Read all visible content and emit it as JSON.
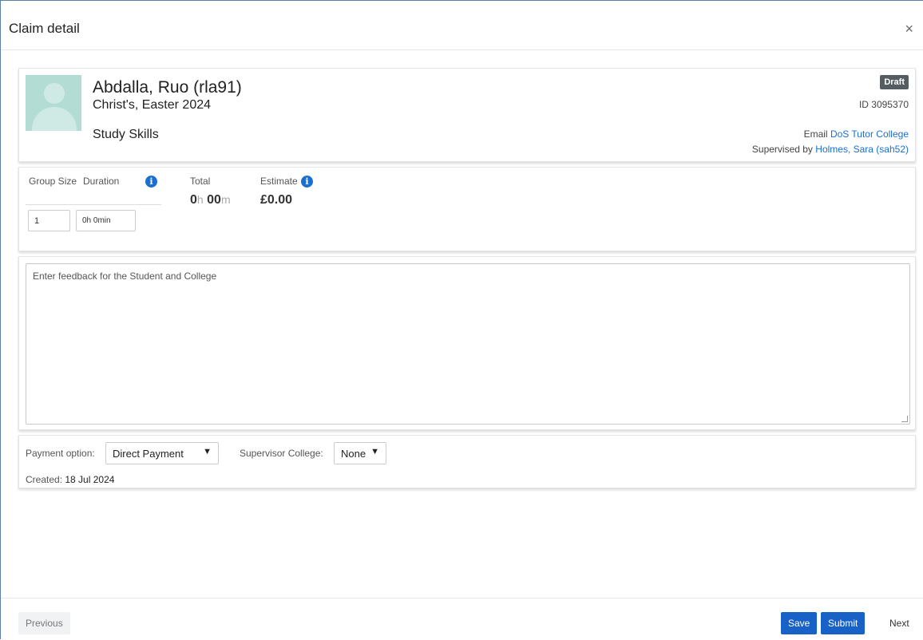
{
  "modal": {
    "title": "Claim detail",
    "close_glyph": "×"
  },
  "student": {
    "name": "Abdalla, Ruo (rla91)",
    "college_term": "Christ's, Easter 2024",
    "course": "Study Skills",
    "status_badge": "Draft",
    "id_text": "ID 3095370",
    "email_label": "Email",
    "email_link": "DoS Tutor College",
    "supervised_label": "Supervised by",
    "supervisor_link": "Holmes, Sara (sah52)"
  },
  "duration": {
    "group_size_label": "Group Size",
    "duration_label": "Duration",
    "total_label": "Total",
    "estimate_label": "Estimate",
    "group_size_value": "1",
    "duration_value": "0h 0min",
    "total_hours": "0",
    "total_h_unit": "h",
    "total_minutes": "00",
    "total_m_unit": "m",
    "estimate_value": "£0.00"
  },
  "feedback": {
    "placeholder": "Enter feedback for the Student and College"
  },
  "payment": {
    "payment_option_label": "Payment option:",
    "payment_option_value": "Direct Payment",
    "supervisor_college_label": "Supervisor College:",
    "supervisor_college_value": "None",
    "created_label": "Created:",
    "created_value": "18 Jul 2024"
  },
  "footer": {
    "previous": "Previous",
    "save": "Save",
    "submit": "Submit",
    "next": "Next"
  },
  "colors": {
    "accent": "#1862c7",
    "link": "#1a6fd1",
    "badge": "#555d63"
  }
}
